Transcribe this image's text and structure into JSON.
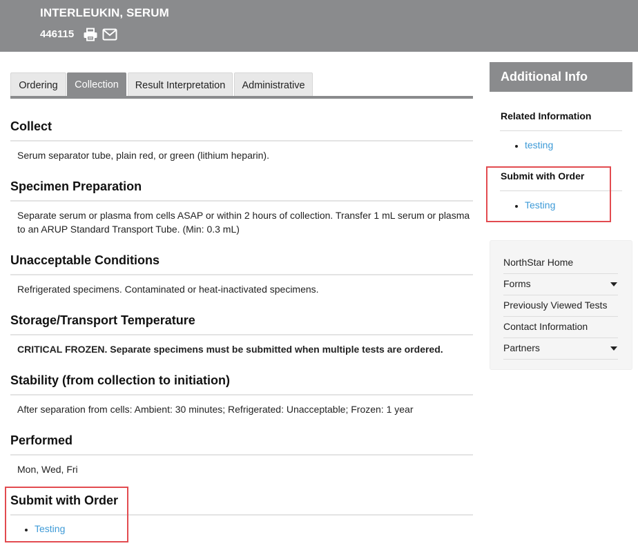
{
  "header": {
    "title": "INTERLEUKIN, SERUM",
    "code": "446115",
    "print_icon": "print-icon",
    "email_icon": "envelope-icon"
  },
  "tabs": [
    {
      "label": "Ordering",
      "active": false
    },
    {
      "label": "Collection",
      "active": true
    },
    {
      "label": "Result Interpretation",
      "active": false
    },
    {
      "label": "Administrative",
      "active": false
    }
  ],
  "sections": {
    "collect": {
      "title": "Collect",
      "text": "Serum separator tube, plain red, or green (lithium heparin)."
    },
    "prep": {
      "title": "Specimen Preparation",
      "line1": "Separate serum or plasma from cells ASAP or within 2 hours of collection. Transfer 1 mL serum or plasma",
      "line2": "to an ARUP Standard Transport Tube. (Min: 0.3 mL)"
    },
    "unacceptable": {
      "title": "Unacceptable Conditions",
      "text": "Refrigerated specimens. Contaminated or heat-inactivated specimens."
    },
    "storage": {
      "title": "Storage/Transport Temperature",
      "text": "CRITICAL FROZEN. Separate specimens must be submitted when multiple tests are ordered."
    },
    "stability": {
      "title": "Stability (from collection to initiation)",
      "text": "After separation from cells: Ambient: 30 minutes; Refrigerated: Unacceptable; Frozen: 1 year"
    },
    "performed": {
      "title": "Performed",
      "text": "Mon, Wed, Fri"
    },
    "submit": {
      "title": "Submit with Order",
      "link": "Testing"
    }
  },
  "sidebar": {
    "title": "Additional Info",
    "related_title": "Related Information",
    "related_link": "testing",
    "submit_title": "Submit with Order",
    "submit_link": "Testing",
    "nav": [
      {
        "label": "NorthStar Home",
        "dropdown": false
      },
      {
        "label": "Forms",
        "dropdown": true
      },
      {
        "label": "Previously Viewed Tests",
        "dropdown": false
      },
      {
        "label": "Contact Information",
        "dropdown": false
      },
      {
        "label": "Partners",
        "dropdown": true
      }
    ]
  },
  "colors": {
    "header_gray": "#8a8b8d",
    "link_blue": "#3d9ad7",
    "highlight_red": "#e24a4f"
  }
}
